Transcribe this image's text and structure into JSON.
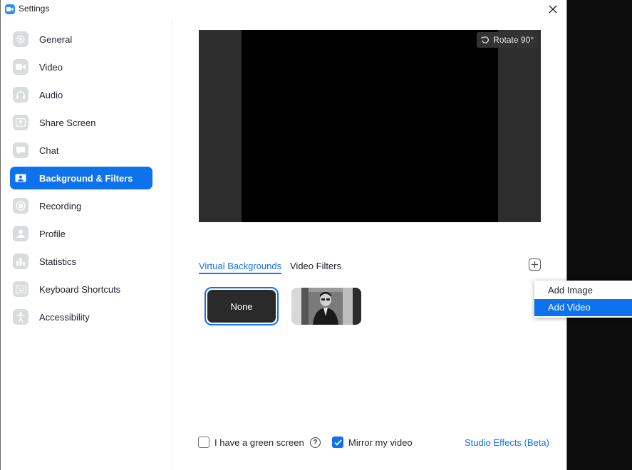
{
  "window": {
    "title": "Settings"
  },
  "sidebar": {
    "items": [
      {
        "label": "General",
        "icon": "gear-icon"
      },
      {
        "label": "Video",
        "icon": "camera-icon"
      },
      {
        "label": "Audio",
        "icon": "headphones-icon"
      },
      {
        "label": "Share Screen",
        "icon": "share-screen-icon"
      },
      {
        "label": "Chat",
        "icon": "chat-icon"
      },
      {
        "label": "Background & Filters",
        "icon": "background-icon",
        "active": true
      },
      {
        "label": "Recording",
        "icon": "record-icon"
      },
      {
        "label": "Profile",
        "icon": "profile-icon"
      },
      {
        "label": "Statistics",
        "icon": "statistics-icon"
      },
      {
        "label": "Keyboard Shortcuts",
        "icon": "keyboard-icon"
      },
      {
        "label": "Accessibility",
        "icon": "accessibility-icon"
      }
    ]
  },
  "preview": {
    "rotate_label": "Rotate 90°"
  },
  "tabs": [
    {
      "label": "Virtual Backgrounds",
      "active": true
    },
    {
      "label": "Video Filters",
      "active": false
    }
  ],
  "backgrounds": {
    "none_label": "None"
  },
  "add_menu": {
    "items": [
      {
        "label": "Add Image",
        "highlighted": false
      },
      {
        "label": "Add Video",
        "highlighted": true
      }
    ]
  },
  "options": {
    "green_screen_label": "I have a green screen",
    "green_screen_checked": false,
    "mirror_label": "Mirror my video",
    "mirror_checked": true,
    "studio_effects_label": "Studio Effects (Beta)"
  },
  "colors": {
    "accent": "#0e72ed"
  }
}
